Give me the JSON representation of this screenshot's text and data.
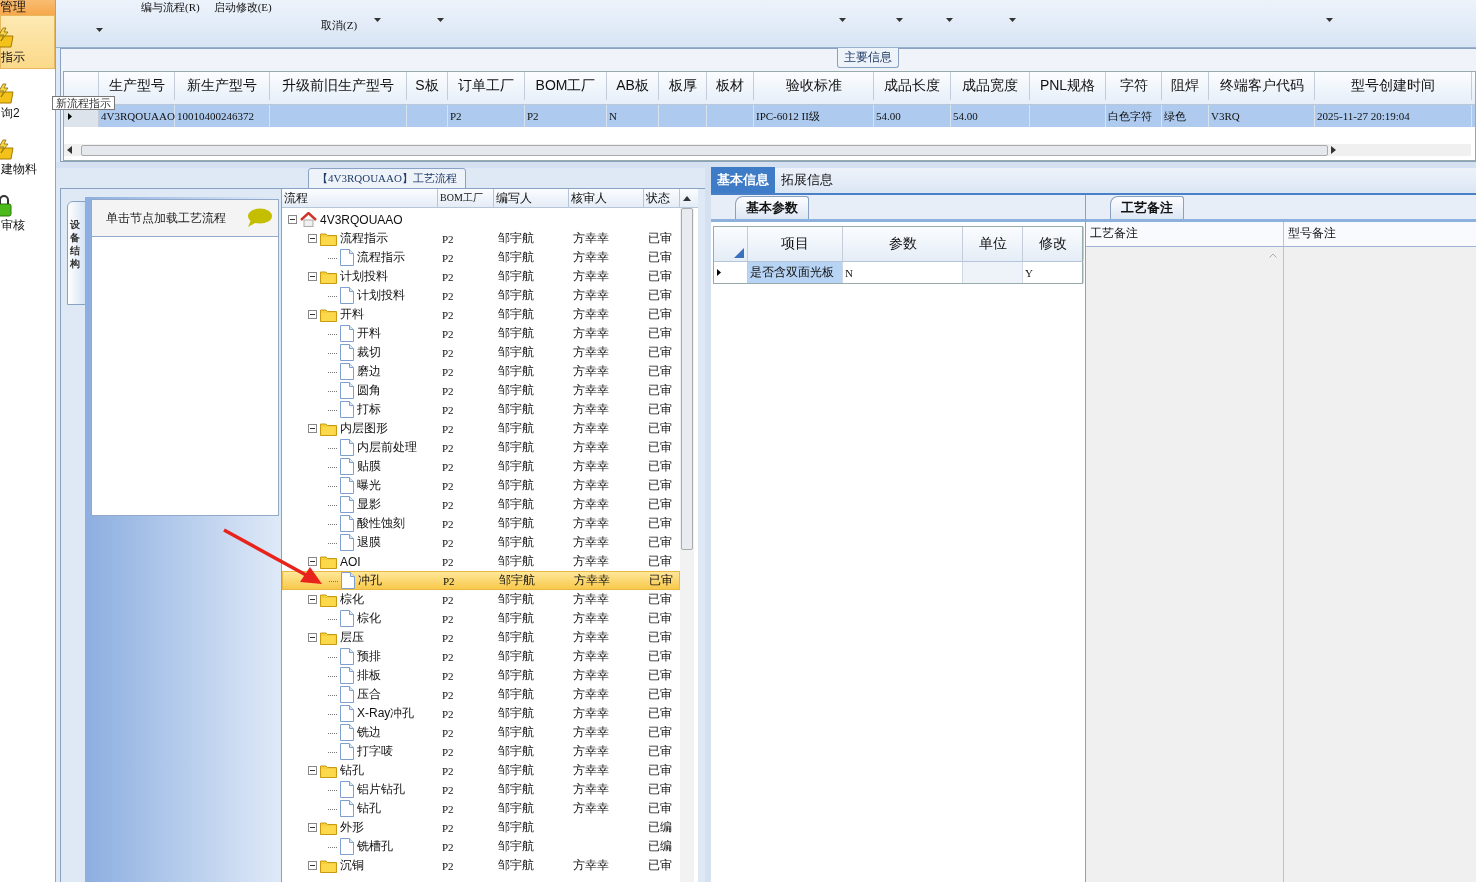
{
  "sidebar": {
    "header": "管理",
    "items": [
      {
        "label": "指示",
        "selected": true,
        "kind": "flow"
      },
      {
        "label": "询2",
        "selected": false,
        "kind": "flow"
      },
      {
        "label": "建物料",
        "selected": false,
        "kind": "flow"
      },
      {
        "label": "审核",
        "selected": false,
        "kind": "audit"
      }
    ]
  },
  "tooltip": "新流程指示",
  "toolbar": {
    "items": [
      {
        "label": "编与流程(R)"
      },
      {
        "label": "启动修改(E)"
      },
      {
        "label": "取消(Z)"
      }
    ]
  },
  "main_info": {
    "title": "主要信息",
    "columns": [
      "生产型号",
      "新生产型号",
      "升级前旧生产型号",
      "S板",
      "订单工厂",
      "BOM工厂",
      "AB板",
      "板厚",
      "板材",
      "验收标准",
      "成品长度",
      "成品宽度",
      "PNL规格",
      "字符",
      "阻焊",
      "终端客户代码",
      "型号创建时间"
    ],
    "rows": [
      {
        "selected": true,
        "cells": [
          "4V3RQOUAAO",
          "10010400246372",
          null,
          null,
          "P2",
          "P2",
          "N",
          null,
          null,
          "IPC-6012 II级",
          "54.00",
          "54.00",
          null,
          "白色字符",
          "绿色",
          "V3RQ",
          "2025-11-27 20:19:04"
        ]
      }
    ]
  },
  "process_panel": {
    "title": "【4V3RQOUAAO】工艺流程",
    "side_tab": "设备结构",
    "hint": "单击节点加载工艺流程",
    "tree": {
      "columns": [
        "流程",
        "BOM工厂",
        "编写人",
        "核审人",
        "状态"
      ],
      "rows": [
        {
          "label": "4V3RQOUAAO",
          "kind": "root",
          "expanded": true,
          "selected": false,
          "children": [
            {
              "label": "流程指示",
              "kind": "folder",
              "expanded": true,
              "selected": false,
              "bom": "P2",
              "writer": "邹宇航",
              "reviewer": "方幸幸",
              "status": "已审",
              "children": [
                {
                  "label": "流程指示",
                  "kind": "step",
                  "selected": false,
                  "bom": "P2",
                  "writer": "邹宇航",
                  "reviewer": "方幸幸",
                  "status": "已审"
                }
              ]
            },
            {
              "label": "计划投料",
              "kind": "folder",
              "expanded": true,
              "selected": false,
              "bom": "P2",
              "writer": "邹宇航",
              "reviewer": "方幸幸",
              "status": "已审",
              "children": [
                {
                  "label": "计划投料",
                  "kind": "step",
                  "selected": false,
                  "bom": "P2",
                  "writer": "邹宇航",
                  "reviewer": "方幸幸",
                  "status": "已审"
                }
              ]
            },
            {
              "label": "开料",
              "kind": "folder",
              "expanded": true,
              "selected": false,
              "bom": "P2",
              "writer": "邹宇航",
              "reviewer": "方幸幸",
              "status": "已审",
              "children": [
                {
                  "label": "开料",
                  "kind": "step",
                  "selected": false,
                  "bom": "P2",
                  "writer": "邹宇航",
                  "reviewer": "方幸幸",
                  "status": "已审"
                },
                {
                  "label": "裁切",
                  "kind": "step",
                  "selected": false,
                  "bom": "P2",
                  "writer": "邹宇航",
                  "reviewer": "方幸幸",
                  "status": "已审"
                },
                {
                  "label": "磨边",
                  "kind": "step",
                  "selected": false,
                  "bom": "P2",
                  "writer": "邹宇航",
                  "reviewer": "方幸幸",
                  "status": "已审"
                },
                {
                  "label": "圆角",
                  "kind": "step",
                  "selected": false,
                  "bom": "P2",
                  "writer": "邹宇航",
                  "reviewer": "方幸幸",
                  "status": "已审"
                },
                {
                  "label": "打标",
                  "kind": "step",
                  "selected": false,
                  "bom": "P2",
                  "writer": "邹宇航",
                  "reviewer": "方幸幸",
                  "status": "已审"
                }
              ]
            },
            {
              "label": "内层图形",
              "kind": "folder",
              "expanded": true,
              "selected": false,
              "bom": "P2",
              "writer": "邹宇航",
              "reviewer": "方幸幸",
              "status": "已审",
              "children": [
                {
                  "label": "内层前处理",
                  "kind": "step",
                  "selected": false,
                  "bom": "P2",
                  "writer": "邹宇航",
                  "reviewer": "方幸幸",
                  "status": "已审"
                },
                {
                  "label": "贴膜",
                  "kind": "step",
                  "selected": false,
                  "bom": "P2",
                  "writer": "邹宇航",
                  "reviewer": "方幸幸",
                  "status": "已审"
                },
                {
                  "label": "曝光",
                  "kind": "step",
                  "selected": false,
                  "bom": "P2",
                  "writer": "邹宇航",
                  "reviewer": "方幸幸",
                  "status": "已审"
                },
                {
                  "label": "显影",
                  "kind": "step",
                  "selected": false,
                  "bom": "P2",
                  "writer": "邹宇航",
                  "reviewer": "方幸幸",
                  "status": "已审"
                },
                {
                  "label": "酸性蚀刻",
                  "kind": "step",
                  "selected": false,
                  "bom": "P2",
                  "writer": "邹宇航",
                  "reviewer": "方幸幸",
                  "status": "已审"
                },
                {
                  "label": "退膜",
                  "kind": "step",
                  "selected": false,
                  "bom": "P2",
                  "writer": "邹宇航",
                  "reviewer": "方幸幸",
                  "status": "已审"
                }
              ]
            },
            {
              "label": "AOI",
              "kind": "folder",
              "expanded": true,
              "selected": false,
              "bom": "P2",
              "writer": "邹宇航",
              "reviewer": "方幸幸",
              "status": "已审",
              "children": [
                {
                  "label": "冲孔",
                  "kind": "step",
                  "selected": true,
                  "bom": "P2",
                  "writer": "邹宇航",
                  "reviewer": "方幸幸",
                  "status": "已审"
                }
              ]
            },
            {
              "label": "棕化",
              "kind": "folder",
              "expanded": true,
              "selected": false,
              "bom": "P2",
              "writer": "邹宇航",
              "reviewer": "方幸幸",
              "status": "已审",
              "children": [
                {
                  "label": "棕化",
                  "kind": "step",
                  "selected": false,
                  "bom": "P2",
                  "writer": "邹宇航",
                  "reviewer": "方幸幸",
                  "status": "已审"
                }
              ]
            },
            {
              "label": "层压",
              "kind": "folder",
              "expanded": true,
              "selected": false,
              "bom": "P2",
              "writer": "邹宇航",
              "reviewer": "方幸幸",
              "status": "已审",
              "children": [
                {
                  "label": "预排",
                  "kind": "step",
                  "selected": false,
                  "bom": "P2",
                  "writer": "邹宇航",
                  "reviewer": "方幸幸",
                  "status": "已审"
                },
                {
                  "label": "排板",
                  "kind": "step",
                  "selected": false,
                  "bom": "P2",
                  "writer": "邹宇航",
                  "reviewer": "方幸幸",
                  "status": "已审"
                },
                {
                  "label": "压合",
                  "kind": "step",
                  "selected": false,
                  "bom": "P2",
                  "writer": "邹宇航",
                  "reviewer": "方幸幸",
                  "status": "已审"
                },
                {
                  "label": "X-Ray冲孔",
                  "kind": "step",
                  "selected": false,
                  "bom": "P2",
                  "writer": "邹宇航",
                  "reviewer": "方幸幸",
                  "status": "已审"
                },
                {
                  "label": "铣边",
                  "kind": "step",
                  "selected": false,
                  "bom": "P2",
                  "writer": "邹宇航",
                  "reviewer": "方幸幸",
                  "status": "已审"
                },
                {
                  "label": "打字唛",
                  "kind": "step",
                  "selected": false,
                  "bom": "P2",
                  "writer": "邹宇航",
                  "reviewer": "方幸幸",
                  "status": "已审"
                }
              ]
            },
            {
              "label": "钻孔",
              "kind": "folder",
              "expanded": true,
              "selected": false,
              "bom": "P2",
              "writer": "邹宇航",
              "reviewer": "方幸幸",
              "status": "已审",
              "children": [
                {
                  "label": "铝片钻孔",
                  "kind": "step",
                  "selected": false,
                  "bom": "P2",
                  "writer": "邹宇航",
                  "reviewer": "方幸幸",
                  "status": "已审"
                },
                {
                  "label": "钻孔",
                  "kind": "step",
                  "selected": false,
                  "bom": "P2",
                  "writer": "邹宇航",
                  "reviewer": "方幸幸",
                  "status": "已审"
                }
              ]
            },
            {
              "label": "外形",
              "kind": "folder",
              "expanded": true,
              "selected": false,
              "bom": "P2",
              "writer": "邹宇航",
              "status": "已编",
              "children": [
                {
                  "label": "铣槽孔",
                  "kind": "step",
                  "selected": false,
                  "bom": "P2",
                  "writer": "邹宇航",
                  "status": "已编"
                }
              ]
            },
            {
              "label": "沉铜",
              "kind": "folder",
              "expanded": true,
              "selected": false,
              "bom": "P2",
              "writer": "邹宇航",
              "reviewer": "方幸幸",
              "status": "已审"
            }
          ]
        }
      ]
    }
  },
  "detail_panel": {
    "tabs": [
      {
        "label": "基本信息",
        "selected": true
      },
      {
        "label": "拓展信息",
        "selected": false
      }
    ],
    "params": {
      "title": "基本参数",
      "columns": [
        "项目",
        "参数",
        "单位",
        "修改"
      ],
      "rows": [
        {
          "item": "是否含双面光板",
          "value": "N",
          "modified": "Y"
        }
      ]
    },
    "remarks": {
      "title": "工艺备注",
      "columns": [
        "工艺备注",
        "型号备注"
      ]
    }
  }
}
